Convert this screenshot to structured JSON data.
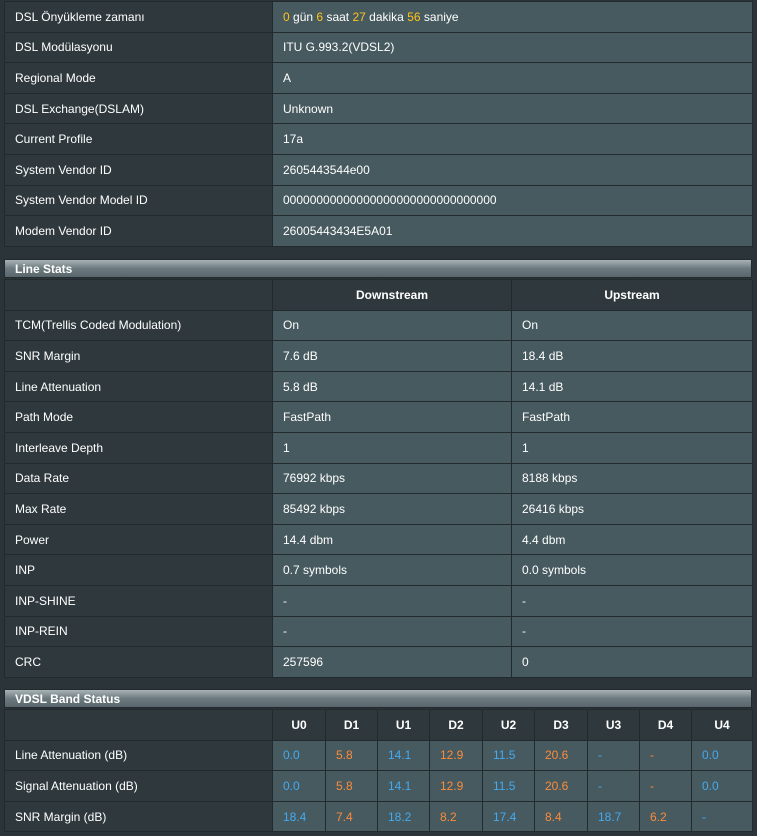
{
  "dsl_info": [
    {
      "label": "DSL Önyükleme zamanı",
      "uptime": {
        "days": "0",
        "days_unit": "gün",
        "hours": "6",
        "hours_unit": "saat",
        "minutes": "27",
        "minutes_unit": "dakika",
        "seconds": "56",
        "seconds_unit": "saniye"
      }
    },
    {
      "label": "DSL Modülasyonu",
      "value": "ITU G.993.2(VDSL2)"
    },
    {
      "label": "Regional Mode",
      "value": "A"
    },
    {
      "label": "DSL Exchange(DSLAM)",
      "value": "Unknown"
    },
    {
      "label": "Current Profile",
      "value": "17a"
    },
    {
      "label": "System Vendor ID",
      "value": "2605443544e00"
    },
    {
      "label": "System Vendor Model ID",
      "value": "00000000000000000000000000000000"
    },
    {
      "label": "Modem Vendor ID",
      "value": "26005443434E5A01"
    }
  ],
  "line_stats": {
    "title": "Line Stats",
    "col_downstream": "Downstream",
    "col_upstream": "Upstream",
    "rows": [
      {
        "label": "TCM(Trellis Coded Modulation)",
        "down": "On",
        "up": "On"
      },
      {
        "label": "SNR Margin",
        "down": "7.6 dB",
        "up": "18.4 dB"
      },
      {
        "label": "Line Attenuation",
        "down": "5.8 dB",
        "up": "14.1 dB"
      },
      {
        "label": "Path Mode",
        "down": "FastPath",
        "up": "FastPath"
      },
      {
        "label": "Interleave Depth",
        "down": "1",
        "up": "1"
      },
      {
        "label": "Data Rate",
        "down": "76992 kbps",
        "up": "8188 kbps"
      },
      {
        "label": "Max Rate",
        "down": "85492 kbps",
        "up": "26416 kbps"
      },
      {
        "label": "Power",
        "down": "14.4 dbm",
        "up": "4.4 dbm"
      },
      {
        "label": "INP",
        "down": "0.7 symbols",
        "up": "0.0 symbols"
      },
      {
        "label": "INP-SHINE",
        "down": "-",
        "up": "-"
      },
      {
        "label": "INP-REIN",
        "down": "-",
        "up": "-"
      },
      {
        "label": "CRC",
        "down": "257596",
        "up": "0"
      }
    ]
  },
  "band_status": {
    "title": "VDSL Band Status",
    "bands": [
      "U0",
      "D1",
      "U1",
      "D2",
      "U2",
      "D3",
      "U3",
      "D4",
      "U4"
    ],
    "rows": [
      {
        "label": "Line Attenuation (dB)",
        "values": [
          "0.0",
          "5.8",
          "14.1",
          "12.9",
          "11.5",
          "20.6",
          "-",
          "-",
          "0.0"
        ]
      },
      {
        "label": "Signal Attenuation (dB)",
        "values": [
          "0.0",
          "5.8",
          "14.1",
          "12.9",
          "11.5",
          "20.6",
          "-",
          "-",
          "0.0"
        ]
      },
      {
        "label": "SNR Margin (dB)",
        "values": [
          "18.4",
          "7.4",
          "18.2",
          "8.2",
          "17.4",
          "8.4",
          "18.7",
          "6.2",
          "-"
        ]
      }
    ]
  },
  "colors": {
    "upstream": "#44aaf0",
    "downstream": "#fb8c3c",
    "highlight": "#ffc419"
  }
}
